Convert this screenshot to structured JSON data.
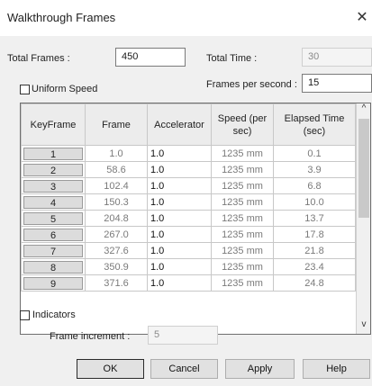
{
  "window": {
    "title": "Walkthrough Frames",
    "close_glyph": "✕"
  },
  "total_frames": {
    "label": "Total Frames :",
    "value": "450"
  },
  "total_time": {
    "label": "Total Time :",
    "value": "30"
  },
  "uniform_speed": {
    "label": "Uniform Speed",
    "checked": false
  },
  "fps": {
    "label": "Frames per second :",
    "value": "15"
  },
  "table": {
    "columns": [
      "KeyFrame",
      "Frame",
      "Accelerator",
      "Speed (per sec)",
      "Elapsed Time (sec)"
    ],
    "rows": [
      {
        "keyframe": "1",
        "frame": "1.0",
        "accelerator": "1.0",
        "speed": "1235 mm",
        "elapsed": "0.1"
      },
      {
        "keyframe": "2",
        "frame": "58.6",
        "accelerator": "1.0",
        "speed": "1235 mm",
        "elapsed": "3.9"
      },
      {
        "keyframe": "3",
        "frame": "102.4",
        "accelerator": "1.0",
        "speed": "1235 mm",
        "elapsed": "6.8"
      },
      {
        "keyframe": "4",
        "frame": "150.3",
        "accelerator": "1.0",
        "speed": "1235 mm",
        "elapsed": "10.0"
      },
      {
        "keyframe": "5",
        "frame": "204.8",
        "accelerator": "1.0",
        "speed": "1235 mm",
        "elapsed": "13.7"
      },
      {
        "keyframe": "6",
        "frame": "267.0",
        "accelerator": "1.0",
        "speed": "1235 mm",
        "elapsed": "17.8"
      },
      {
        "keyframe": "7",
        "frame": "327.6",
        "accelerator": "1.0",
        "speed": "1235 mm",
        "elapsed": "21.8"
      },
      {
        "keyframe": "8",
        "frame": "350.9",
        "accelerator": "1.0",
        "speed": "1235 mm",
        "elapsed": "23.4"
      },
      {
        "keyframe": "9",
        "frame": "371.6",
        "accelerator": "1.0",
        "speed": "1235 mm",
        "elapsed": "24.8"
      }
    ]
  },
  "scrollbar": {
    "up_glyph": "^",
    "down_glyph": "v"
  },
  "indicators": {
    "label": "Indicators",
    "checked": false
  },
  "frame_increment": {
    "label": "Frame increment :",
    "value": "5"
  },
  "buttons": {
    "ok": "OK",
    "cancel": "Cancel",
    "apply": "Apply",
    "help": "Help"
  }
}
